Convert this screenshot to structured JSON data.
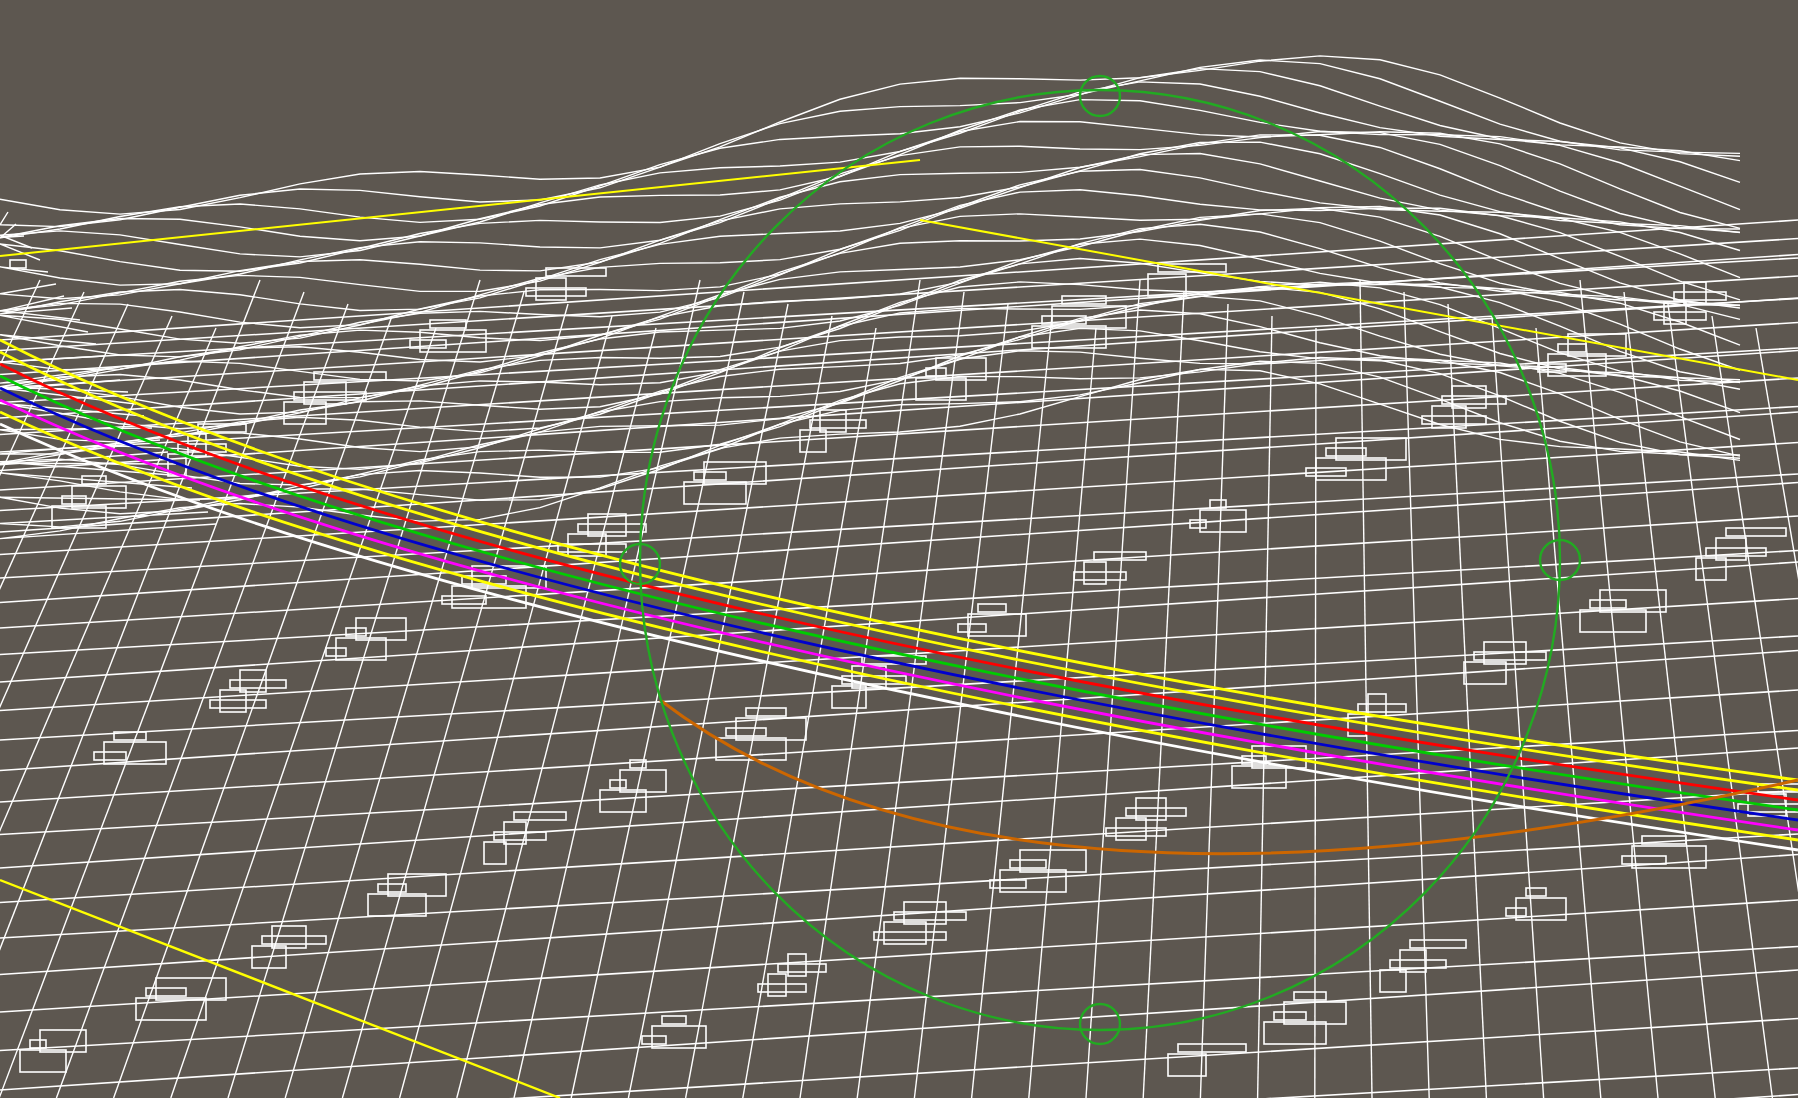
{
  "viewport": {
    "kind": "wireframe",
    "orbit_gizmo": true
  }
}
